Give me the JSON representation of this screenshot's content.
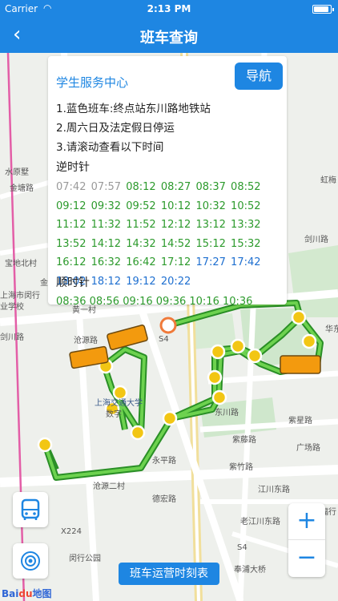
{
  "status": {
    "carrier": "Carrier",
    "time": "2:13 PM",
    "battery_level": 0.9
  },
  "nav": {
    "title": "班车查询"
  },
  "card": {
    "name": "学生服务中心",
    "nav_button": "导航",
    "notes": [
      "1.蓝色班车:终点站东川路地铁站",
      "2.周六日及法定假日停运",
      "3.请滚动查看以下时间"
    ],
    "ccw_label": "逆时针",
    "ccw_times": [
      {
        "t": "07:42",
        "s": "past"
      },
      {
        "t": "07:57",
        "s": "past"
      },
      {
        "t": "08:12",
        "s": "green"
      },
      {
        "t": "08:27",
        "s": "green"
      },
      {
        "t": "08:37",
        "s": "green"
      },
      {
        "t": "08:52",
        "s": "green"
      },
      {
        "t": "09:12",
        "s": "green"
      },
      {
        "t": "09:32",
        "s": "green"
      },
      {
        "t": "09:52",
        "s": "green"
      },
      {
        "t": "10:12",
        "s": "green"
      },
      {
        "t": "10:32",
        "s": "green"
      },
      {
        "t": "10:52",
        "s": "green"
      },
      {
        "t": "11:12",
        "s": "green"
      },
      {
        "t": "11:32",
        "s": "green"
      },
      {
        "t": "11:52",
        "s": "green"
      },
      {
        "t": "12:12",
        "s": "green"
      },
      {
        "t": "13:12",
        "s": "green"
      },
      {
        "t": "13:32",
        "s": "green"
      },
      {
        "t": "13:52",
        "s": "green"
      },
      {
        "t": "14:12",
        "s": "green"
      },
      {
        "t": "14:32",
        "s": "green"
      },
      {
        "t": "14:52",
        "s": "green"
      },
      {
        "t": "15:12",
        "s": "green"
      },
      {
        "t": "15:32",
        "s": "green"
      },
      {
        "t": "16:12",
        "s": "green"
      },
      {
        "t": "16:32",
        "s": "green"
      },
      {
        "t": "16:42",
        "s": "green"
      },
      {
        "t": "17:12",
        "s": "green"
      },
      {
        "t": "17:27",
        "s": "blue"
      },
      {
        "t": "17:42",
        "s": "blue"
      },
      {
        "t": "18:02",
        "s": "blue"
      },
      {
        "t": "18:12",
        "s": "blue"
      },
      {
        "t": "19:12",
        "s": "blue"
      },
      {
        "t": "20:22",
        "s": "blue"
      }
    ],
    "cw_label": "顺时针",
    "cw_times_partial": "08:36 08:56 09:16 09:36 10:16 10:36"
  },
  "map_labels": {
    "l1": "水原墅",
    "l2": "金塘路",
    "l3": "宝地北村",
    "l4": "金杉路",
    "l5": "上海市闵行",
    "l6": "业学校",
    "l7": "剑川路",
    "l8": "沧源路",
    "l9": "上海交通大学",
    "l10": "数字",
    "l11": "东川路",
    "l12": "紫星路",
    "l13": "紫藤路",
    "l14": "紫竹路",
    "l15": "江川东路",
    "l16": "沧源二村",
    "l17": "永平路",
    "l18": "德宏路",
    "l19": "老江川东路",
    "l20": "闵行公园",
    "l21": "奉浦大桥",
    "l22": "广场路",
    "l23": "华东",
    "l24": "虹梅",
    "l25": "剑川路",
    "l26": "黄一村",
    "l27": "S4",
    "l28": "S4",
    "l29": "X224",
    "l30": "福行"
  },
  "controls": {
    "zoom_in": "+",
    "zoom_out": "−",
    "timetable_button": "班车运营时刻表"
  },
  "branding": {
    "logo_text": "Bai",
    "logo_mid": "du",
    "logo_end": "地图"
  },
  "colors": {
    "primary": "#1e86e2",
    "route_green": "#3aa832",
    "stop_yellow": "#f2c614",
    "bus_orange": "#f39a0e"
  }
}
